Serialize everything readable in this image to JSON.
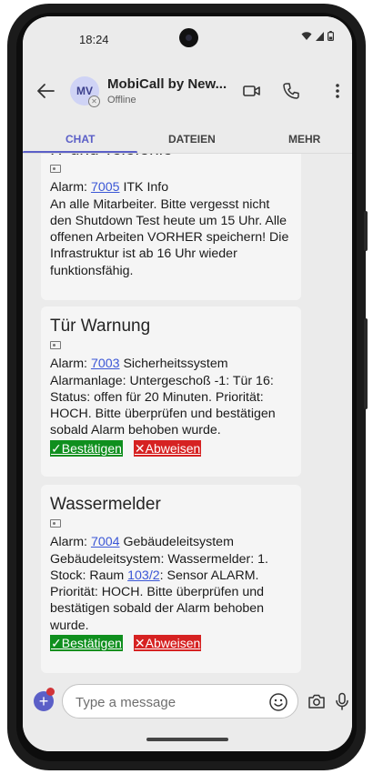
{
  "status_bar": {
    "time": "18:24"
  },
  "header": {
    "avatar_initials": "MV",
    "name": "MobiCall by New...",
    "status": "Offline"
  },
  "tabs": [
    {
      "label": "CHAT",
      "active": true
    },
    {
      "label": "DATEIEN",
      "active": false
    },
    {
      "label": "MEHR",
      "active": false
    }
  ],
  "messages": [
    {
      "title": "IT und Telefonie",
      "alarm_prefix": "Alarm: ",
      "alarm_code": "7005",
      "alarm_system": " ITK Info",
      "body": "An alle Mitarbeiter. Bitte vergesst nicht den Shutdown Test heute um 15 Uhr. Alle offenen Arbeiten VORHER speichern! Die Infrastruktur ist ab 16 Uhr wieder funktionsfähig."
    },
    {
      "title": "Tür Warnung",
      "alarm_prefix": "Alarm: ",
      "alarm_code": "7003",
      "alarm_system": " Sicherheitssystem",
      "body": "Alarmanlage: Untergeschoß -1: Tür 16: Status: offen für 20 Minuten. Priorität: HOCH. Bitte überprüfen und bestätigen sobald Alarm behoben wurde.",
      "confirm_label": "✓Bestätigen",
      "dismiss_label": "✕Abweisen"
    },
    {
      "title": "Wassermelder",
      "alarm_prefix": "Alarm: ",
      "alarm_code": "7004",
      "alarm_system": " Gebäudeleitsystem",
      "body_part1": "Gebäudeleitsystem: Wassermelder: 1. Stock: Raum ",
      "room_link": "103/2",
      "body_part2": ": Sensor ALARM. Priorität: HOCH. Bitte überprüfen und bestätigen sobald der Alarm behoben wurde.",
      "confirm_label": "✓Bestätigen",
      "dismiss_label": "✕Abweisen"
    }
  ],
  "composer": {
    "placeholder": "Type a message"
  },
  "colors": {
    "accent": "#5b5fc7",
    "confirm": "#0f8f1e",
    "dismiss": "#d62222",
    "link": "#3b57d6"
  }
}
